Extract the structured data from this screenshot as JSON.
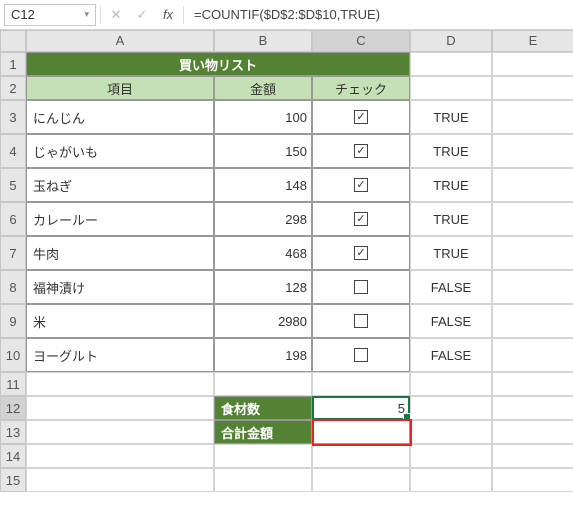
{
  "formula_bar": {
    "cell_ref": "C12",
    "formula": "=COUNTIF($D$2:$D$10,TRUE)"
  },
  "columns": [
    "A",
    "B",
    "C",
    "D",
    "E"
  ],
  "row_numbers": [
    "1",
    "2",
    "3",
    "4",
    "5",
    "6",
    "7",
    "8",
    "9",
    "10",
    "11",
    "12",
    "13",
    "14",
    "15"
  ],
  "title": "買い物リスト",
  "subheaders": {
    "item": "項目",
    "amount": "金額",
    "check": "チェック"
  },
  "items": [
    {
      "name": "にんじん",
      "amount": "100",
      "checked": true,
      "flag": "TRUE"
    },
    {
      "name": "じゃがいも",
      "amount": "150",
      "checked": true,
      "flag": "TRUE"
    },
    {
      "name": "玉ねぎ",
      "amount": "148",
      "checked": true,
      "flag": "TRUE"
    },
    {
      "name": "カレールー",
      "amount": "298",
      "checked": true,
      "flag": "TRUE"
    },
    {
      "name": "牛肉",
      "amount": "468",
      "checked": true,
      "flag": "TRUE"
    },
    {
      "name": "福神漬け",
      "amount": "128",
      "checked": false,
      "flag": "FALSE"
    },
    {
      "name": "米",
      "amount": "2980",
      "checked": false,
      "flag": "FALSE"
    },
    {
      "name": "ヨーグルト",
      "amount": "198",
      "checked": false,
      "flag": "FALSE"
    }
  ],
  "summary": {
    "count_label": "食材数",
    "count_value": "5",
    "total_label": "合計金額",
    "total_value": ""
  },
  "icons": {
    "caret": "▾",
    "cancel": "✕",
    "enter": "✓",
    "fx": "fx",
    "checkmark": "✓"
  }
}
